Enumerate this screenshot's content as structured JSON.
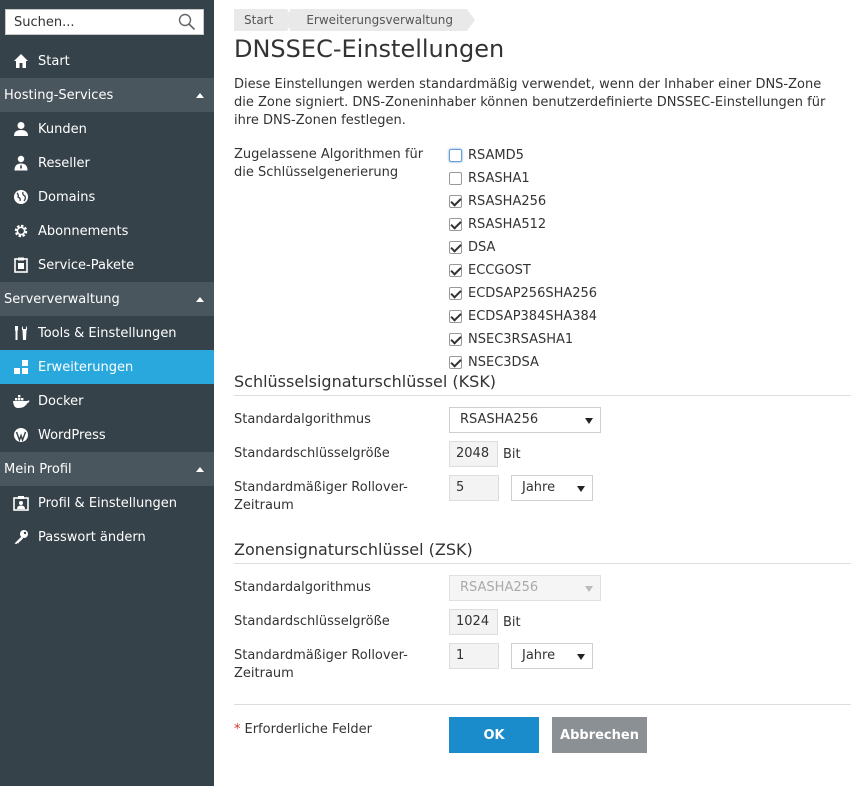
{
  "sidebar": {
    "search_placeholder": "Suchen...",
    "start": "Start",
    "groups": [
      {
        "title": "Hosting-Services",
        "items": [
          "Kunden",
          "Reseller",
          "Domains",
          "Abonnements",
          "Service-Pakete"
        ]
      },
      {
        "title": "Serververwaltung",
        "items": [
          "Tools & Einstellungen",
          "Erweiterungen",
          "Docker",
          "WordPress"
        ]
      },
      {
        "title": "Mein Profil",
        "items": [
          "Profil & Einstellungen",
          "Passwort ändern"
        ]
      }
    ],
    "active_item": "Erweiterungen",
    "colors": {
      "background": "#36424a",
      "group_header": "#4a565e",
      "active": "#28a8dd"
    }
  },
  "breadcrumb": [
    "Start",
    "Erweiterungsverwaltung"
  ],
  "page_title": "DNSSEC-Einstellungen",
  "intro": "Diese Einstellungen werden standardmäßig verwendet, wenn der Inhaber einer DNS-Zone die Zone signiert. DNS-Zoneninhaber können benutzerdefinierte DNSSEC-Einstellungen für ihre DNS-Zonen festlegen.",
  "algorithms": {
    "label": "Zugelassene Algorithmen für die Schlüsselgenerierung",
    "options": [
      {
        "name": "RSAMD5",
        "checked": false
      },
      {
        "name": "RSASHA1",
        "checked": false
      },
      {
        "name": "RSASHA256",
        "checked": true
      },
      {
        "name": "RSASHA512",
        "checked": true
      },
      {
        "name": "DSA",
        "checked": true
      },
      {
        "name": "ECCGOST",
        "checked": true
      },
      {
        "name": "ECDSAP256SHA256",
        "checked": true
      },
      {
        "name": "ECDSAP384SHA384",
        "checked": true
      },
      {
        "name": "NSEC3RSASHA1",
        "checked": true
      },
      {
        "name": "NSEC3DSA",
        "checked": true
      }
    ]
  },
  "ksk": {
    "title": "Schlüsselsignaturschlüssel (KSK)",
    "algorithm_label": "Standardalgorithmus",
    "algorithm_value": "RSASHA256",
    "keysize_label": "Standardschlüsselgröße",
    "keysize_value": "2048",
    "keysize_unit": "Bit",
    "rollover_label": "Standardmäßiger Rollover-Zeitraum",
    "rollover_value": "5",
    "rollover_unit": "Jahre"
  },
  "zsk": {
    "title": "Zonensignaturschlüssel (ZSK)",
    "algorithm_label": "Standardalgorithmus",
    "algorithm_value": "RSASHA256",
    "keysize_label": "Standardschlüsselgröße",
    "keysize_value": "1024",
    "keysize_unit": "Bit",
    "rollover_label": "Standardmäßiger Rollover-Zeitraum",
    "rollover_value": "1",
    "rollover_unit": "Jahre"
  },
  "footer": {
    "required_note": "Erforderliche Felder",
    "ok_label": "OK",
    "cancel_label": "Abbrechen"
  },
  "colors": {
    "ok_button": "#1a8ccc",
    "cancel_button": "#8a9094",
    "required_star": "#d9302c"
  }
}
